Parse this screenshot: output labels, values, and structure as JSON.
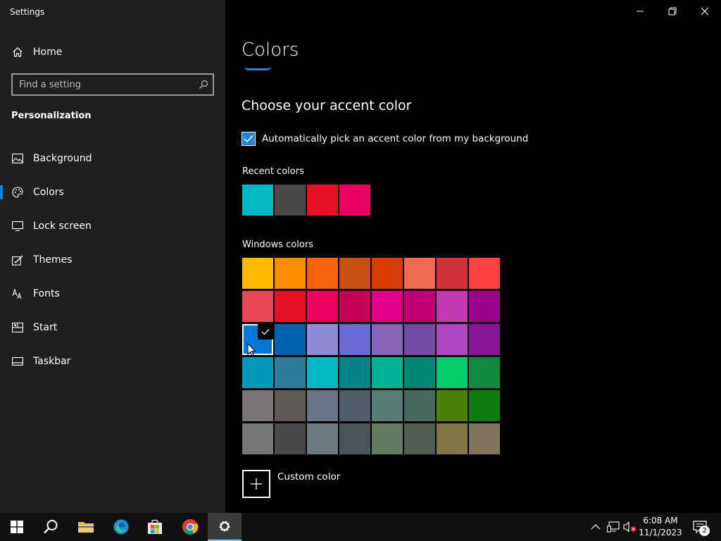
{
  "app": {
    "title": "Settings"
  },
  "sidebar": {
    "home_label": "Home",
    "search_placeholder": "Find a setting",
    "section": "Personalization",
    "items": [
      {
        "label": "Background",
        "icon": "image-icon"
      },
      {
        "label": "Colors",
        "icon": "palette-icon",
        "selected": true
      },
      {
        "label": "Lock screen",
        "icon": "lock-screen-icon"
      },
      {
        "label": "Themes",
        "icon": "themes-icon"
      },
      {
        "label": "Fonts",
        "icon": "fonts-icon"
      },
      {
        "label": "Start",
        "icon": "start-icon"
      },
      {
        "label": "Taskbar",
        "icon": "taskbar-icon"
      }
    ]
  },
  "main": {
    "title": "Colors",
    "subtitle": "Choose your accent color",
    "auto_pick_label": "Automatically pick an accent color from my background",
    "auto_pick_checked": true,
    "recent_label": "Recent colors",
    "recent_colors": [
      "#00b7c3",
      "#4c4a48",
      "#e81123",
      "#ea005e"
    ],
    "windows_label": "Windows colors",
    "windows_colors": [
      [
        "#ffb900",
        "#ff8c00",
        "#f7630c",
        "#ca5010",
        "#da3b01",
        "#ef6950",
        "#d13438",
        "#ff4343"
      ],
      [
        "#e74856",
        "#e81123",
        "#ea005e",
        "#c30052",
        "#e3008c",
        "#bf0077",
        "#c239b3",
        "#9a0089"
      ],
      [
        "#0078d7",
        "#0063b1",
        "#8e8cd8",
        "#6b69d6",
        "#8764b8",
        "#744da9",
        "#b146c2",
        "#881798"
      ],
      [
        "#0099bc",
        "#2d7d9a",
        "#00b7c3",
        "#038387",
        "#00b294",
        "#018574",
        "#00cc6a",
        "#10893e"
      ],
      [
        "#7a7574",
        "#5d5a58",
        "#68768a",
        "#515c6b",
        "#567c73",
        "#486860",
        "#498205",
        "#107c10"
      ],
      [
        "#767676",
        "#4c4a48",
        "#69797e",
        "#4a5459",
        "#647c64",
        "#525e54",
        "#847545",
        "#7e735f"
      ]
    ],
    "selected_color": "#0078d7",
    "custom_label": "Custom color"
  },
  "taskbar": {
    "time": "6:08 AM",
    "date": "11/1/2023",
    "notification_count": "2"
  }
}
